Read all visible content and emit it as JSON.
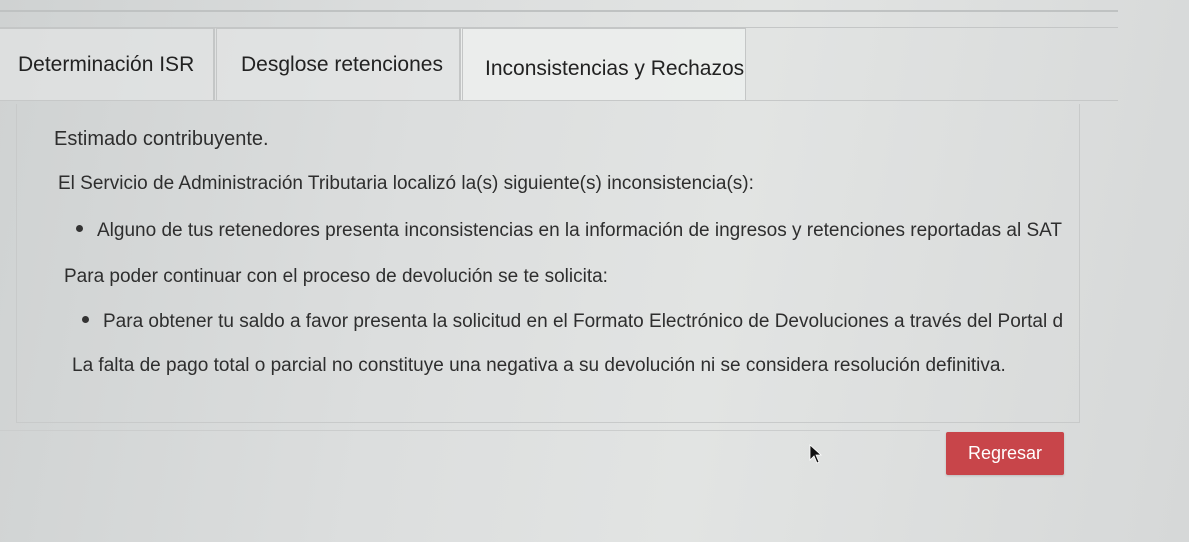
{
  "tabs": [
    {
      "label": "Determinación ISR"
    },
    {
      "label": "Desglose retenciones"
    },
    {
      "label": "Inconsistencias y Rechazos"
    }
  ],
  "message": {
    "greeting": "Estimado contribuyente.",
    "intro": "El Servicio de Administración Tributaria localizó la(s) siguiente(s) inconsistencia(s):",
    "inconsistency_item": "Alguno de tus retenedores presenta inconsistencias en la información de ingresos y retenciones reportadas al SAT",
    "request_intro": "Para poder continuar con el proceso de devolución se te solicita:",
    "request_item": "Para obtener tu saldo a favor presenta la solicitud en el Formato Electrónico de Devoluciones a través del Portal d",
    "note": "La falta de pago total o parcial no constituye una negativa a su devolución ni se considera resolución definitiva."
  },
  "actions": {
    "back_label": "Regresar"
  },
  "colors": {
    "accent": "#c8454a",
    "background": "#dcdede"
  },
  "icons": {
    "cursor": "mouse-pointer-icon"
  }
}
